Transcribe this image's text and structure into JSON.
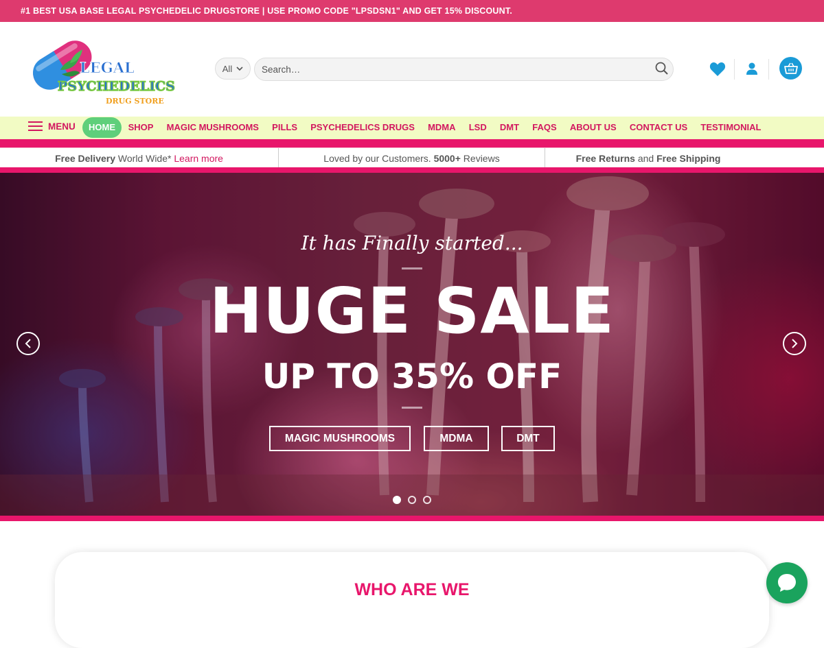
{
  "promo_bar": {
    "text": "#1 BEST USA BASE LEGAL PSYCHEDELIC DRUGSTORE | USE PROMO CODE \"LPSDSN1\" AND GET 15% DISCOUNT."
  },
  "header": {
    "logo": {
      "line1": "LEGAL",
      "line2": "PSYCHEDELICS",
      "line3": "DRUG STORE"
    },
    "search": {
      "category_selected": "All",
      "placeholder": "Search…"
    },
    "icons": [
      "heart-icon",
      "user-icon",
      "basket-icon"
    ],
    "accent_color": "#1a9bd7"
  },
  "nav": {
    "menu_label": "MENU",
    "items": [
      {
        "label": "HOME",
        "active": true
      },
      {
        "label": "SHOP"
      },
      {
        "label": "MAGIC MUSHROOMS"
      },
      {
        "label": "PILLS"
      },
      {
        "label": "PSYCHEDELICS DRUGS"
      },
      {
        "label": "MDMA"
      },
      {
        "label": "LSD"
      },
      {
        "label": "DMT"
      },
      {
        "label": "FAQS"
      },
      {
        "label": "ABOUT US"
      },
      {
        "label": "CONTACT US"
      },
      {
        "label": "TESTIMONIAL"
      }
    ],
    "text_color": "#d2175f",
    "active_bg": "#5fcf7b"
  },
  "usp": {
    "delivery_bold": "Free Delivery",
    "delivery_text": " World Wide* ",
    "delivery_link": "Learn more",
    "reviews_text": "Loved by our Customers. ",
    "reviews_bold": "5000+",
    "reviews_suffix": " Reviews",
    "returns_bold": "Free Returns",
    "returns_mid": " and ",
    "shipping_bold": "Free Shipping"
  },
  "hero": {
    "tagline": "It has Finally started...",
    "title": "HUGE SALE",
    "subtitle": "UP TO 35% OFF",
    "buttons": [
      "MAGIC MUSHROOMS",
      "MDMA",
      "DMT"
    ],
    "slides_count": 3,
    "active_slide": 1
  },
  "about": {
    "title": "WHO ARE WE"
  },
  "brand_colors": {
    "pink": "#e8166b",
    "promo_bg": "#de3a6e",
    "nav_bg": "#f2fbc4",
    "chat_green": "#1aa35d"
  }
}
